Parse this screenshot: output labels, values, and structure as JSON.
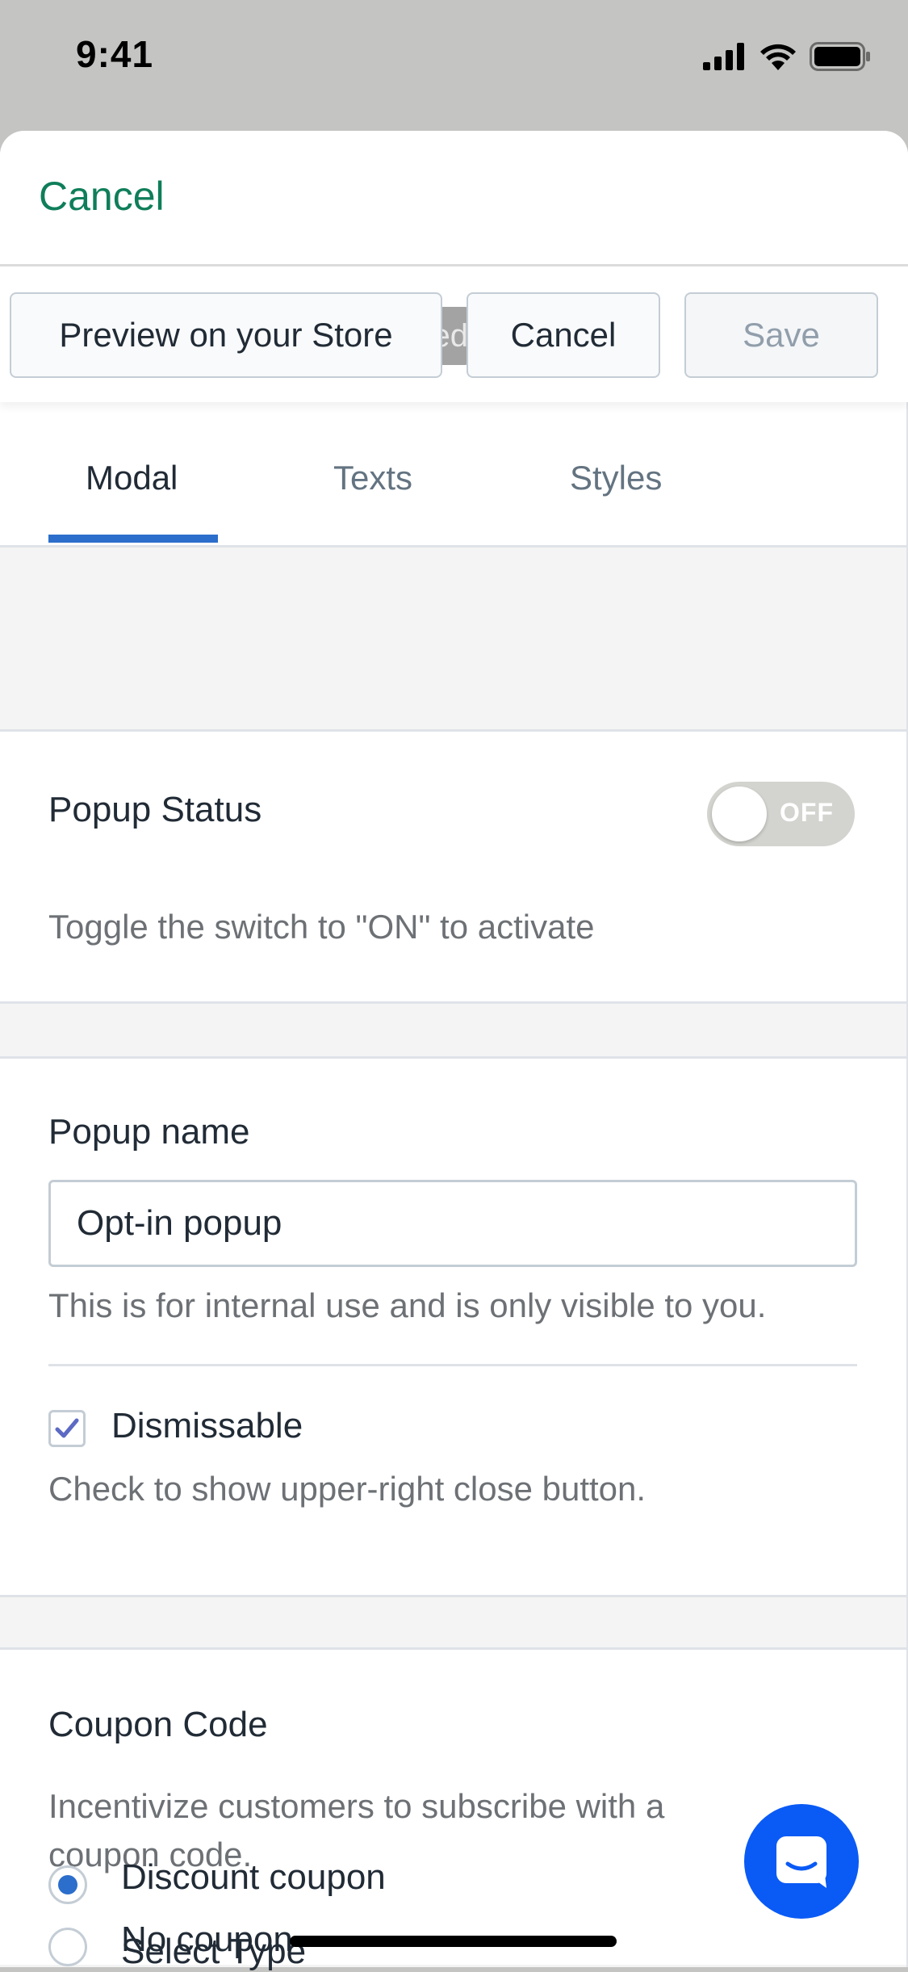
{
  "status_bar": {
    "time": "9:41",
    "signal_icon": "cellular-signal-icon",
    "wifi_icon": "wifi-icon",
    "battery_icon": "battery-icon"
  },
  "sheet": {
    "cancel_label": "Cancel"
  },
  "toolbar": {
    "preview_label": "Preview on your Store",
    "saved_badge_fragment": "ed",
    "cancel_label": "Cancel",
    "save_label": "Save"
  },
  "tabs": [
    {
      "label": "Modal",
      "active": true
    },
    {
      "label": "Texts",
      "active": false
    },
    {
      "label": "Styles",
      "active": false
    }
  ],
  "popup_status": {
    "heading": "Popup Status",
    "toggle_value": "OFF",
    "help": "Toggle the switch to \"ON\" to activate"
  },
  "popup_name": {
    "heading": "Popup name",
    "value": "Opt-in popup",
    "help": "This is for internal use and is only visible to you.",
    "dismissable_label": "Dismissable",
    "dismissable_checked": true,
    "dismissable_help": "Check to show upper-right close button."
  },
  "coupon": {
    "heading": "Coupon Code",
    "help_line1": "Incentivize customers to subscribe with a",
    "help_line2": "coupon code.",
    "options": [
      {
        "label": "No coupon",
        "selected": false
      },
      {
        "label": "Discount coupon",
        "selected": true
      }
    ],
    "select_type_label": "Select Type"
  },
  "chat": {
    "icon": "chat-bubble-icon"
  },
  "colors": {
    "accent": "#2c6ecb",
    "cancel_link": "#0f7e5a",
    "chat_fab": "#0a5af5"
  }
}
